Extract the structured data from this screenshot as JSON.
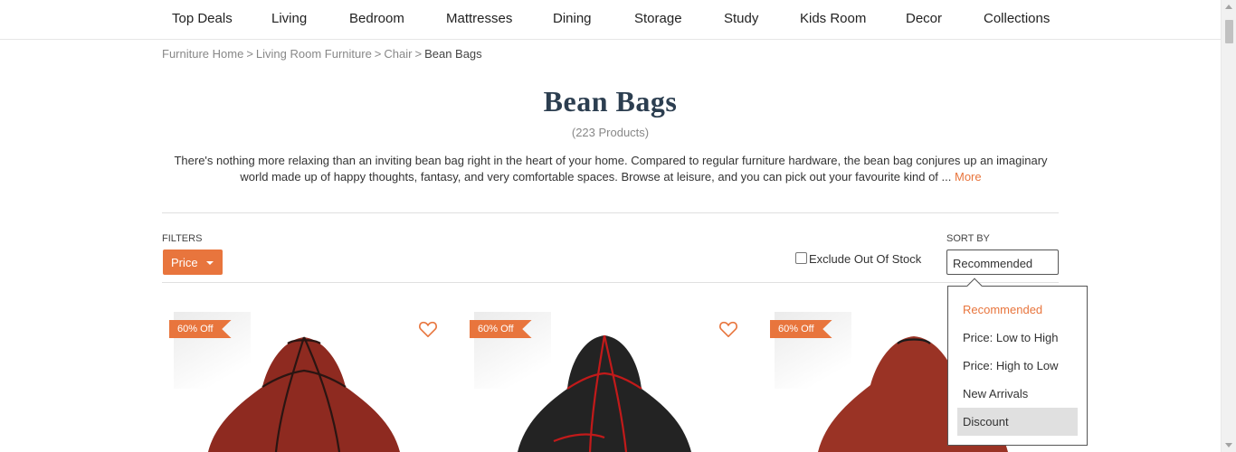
{
  "nav": {
    "items": [
      {
        "label": "Top Deals"
      },
      {
        "label": "Living"
      },
      {
        "label": "Bedroom"
      },
      {
        "label": "Mattresses"
      },
      {
        "label": "Dining"
      },
      {
        "label": "Storage"
      },
      {
        "label": "Study"
      },
      {
        "label": "Kids Room"
      },
      {
        "label": "Decor"
      },
      {
        "label": "Collections"
      }
    ]
  },
  "breadcrumb": {
    "items": [
      "Furniture Home",
      "Living Room Furniture",
      "Chair"
    ],
    "separator": ">",
    "current": "Bean Bags"
  },
  "page": {
    "title": "Bean Bags",
    "count": "(223 Products)",
    "description": "There's nothing more relaxing than an inviting bean bag right in the heart of your home. Compared to regular furniture hardware, the bean bag conjures up an imaginary world made up of happy thoughts, fantasy, and very comfortable spaces. Browse at leisure, and you can pick out your favourite kind of ...",
    "more_label": "More"
  },
  "filters": {
    "label": "FILTERS",
    "price_label": "Price",
    "exclude_label": "Exclude Out Of Stock",
    "exclude_checked": false
  },
  "sort": {
    "label": "SORT BY",
    "selected": "Recommended",
    "options": [
      "Recommended",
      "Price: Low to High",
      "Price: High to Low",
      "New Arrivals",
      "Discount"
    ],
    "active_option": "Recommended",
    "hovered_option": "Discount"
  },
  "products": [
    {
      "badge": "60% Off",
      "color": "#8e2a20",
      "piping": "#2a1512",
      "icon": "heart-outline-icon"
    },
    {
      "badge": "60% Off",
      "color": "#232323",
      "piping": "#c21a1a",
      "icon": "heart-outline-icon"
    },
    {
      "badge": "60% Off",
      "color": "#9a3325",
      "piping": "#1b1b1b",
      "icon": "heart-outline-icon"
    }
  ],
  "theme": {
    "accent": "#e8753d",
    "title_color": "#2c3e50"
  }
}
